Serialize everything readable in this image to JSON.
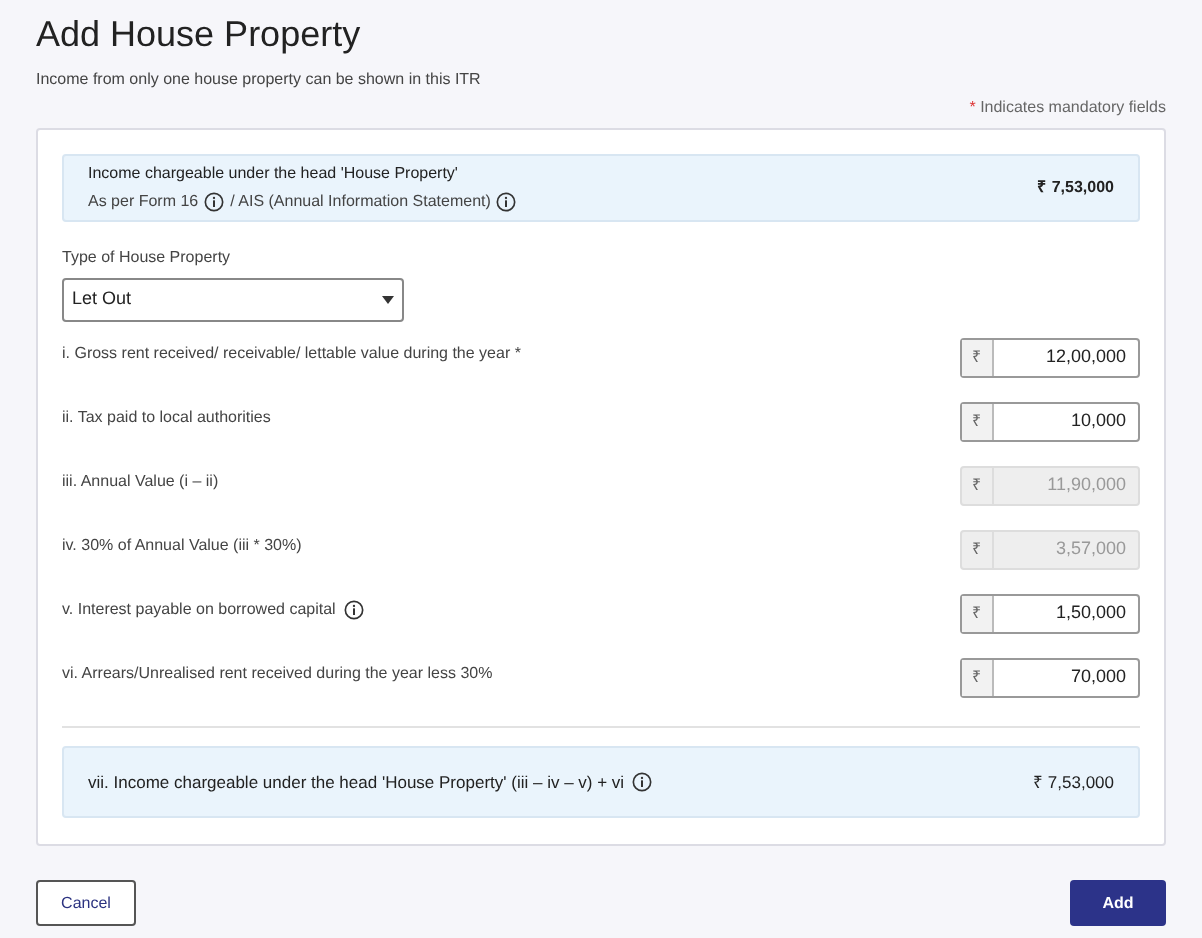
{
  "title": "Add House Property",
  "subtitle": "Income from only one house property can be shown in this ITR",
  "mandatory_note": {
    "mark": "*",
    "text": "Indicates mandatory fields"
  },
  "summary": {
    "title": "Income chargeable under the head 'House Property'",
    "sources": [
      "As per Form 16",
      "/ AIS (Annual Information Statement)"
    ],
    "amount": "₹ 7,53,000"
  },
  "property_type": {
    "label": "Type of House Property",
    "value": "Let Out"
  },
  "rows": [
    {
      "label": "i. Gross rent received/ receivable/ lettable value during the year *",
      "currency": "₹",
      "value": "12,00,000",
      "disabled": false,
      "info": false
    },
    {
      "label": "ii. Tax paid to local authorities",
      "currency": "₹",
      "value": "10,000",
      "disabled": false,
      "info": false
    },
    {
      "label": "iii. Annual Value (i – ii)",
      "currency": "₹",
      "value": "11,90,000",
      "disabled": true,
      "info": false
    },
    {
      "label": "iv. 30% of Annual Value (iii * 30%)",
      "currency": "₹",
      "value": "3,57,000",
      "disabled": true,
      "info": false
    },
    {
      "label": "v. Interest payable on borrowed capital",
      "currency": "₹",
      "value": "1,50,000",
      "disabled": false,
      "info": true
    },
    {
      "label": "vi. Arrears/Unrealised rent received during the year less 30%",
      "currency": "₹",
      "value": "70,000",
      "disabled": false,
      "info": false
    }
  ],
  "total": {
    "label": "vii. Income chargeable under the head 'House Property' (iii – iv – v) + vi",
    "amount": "₹ 7,53,000"
  },
  "buttons": {
    "cancel": "Cancel",
    "add": "Add"
  }
}
